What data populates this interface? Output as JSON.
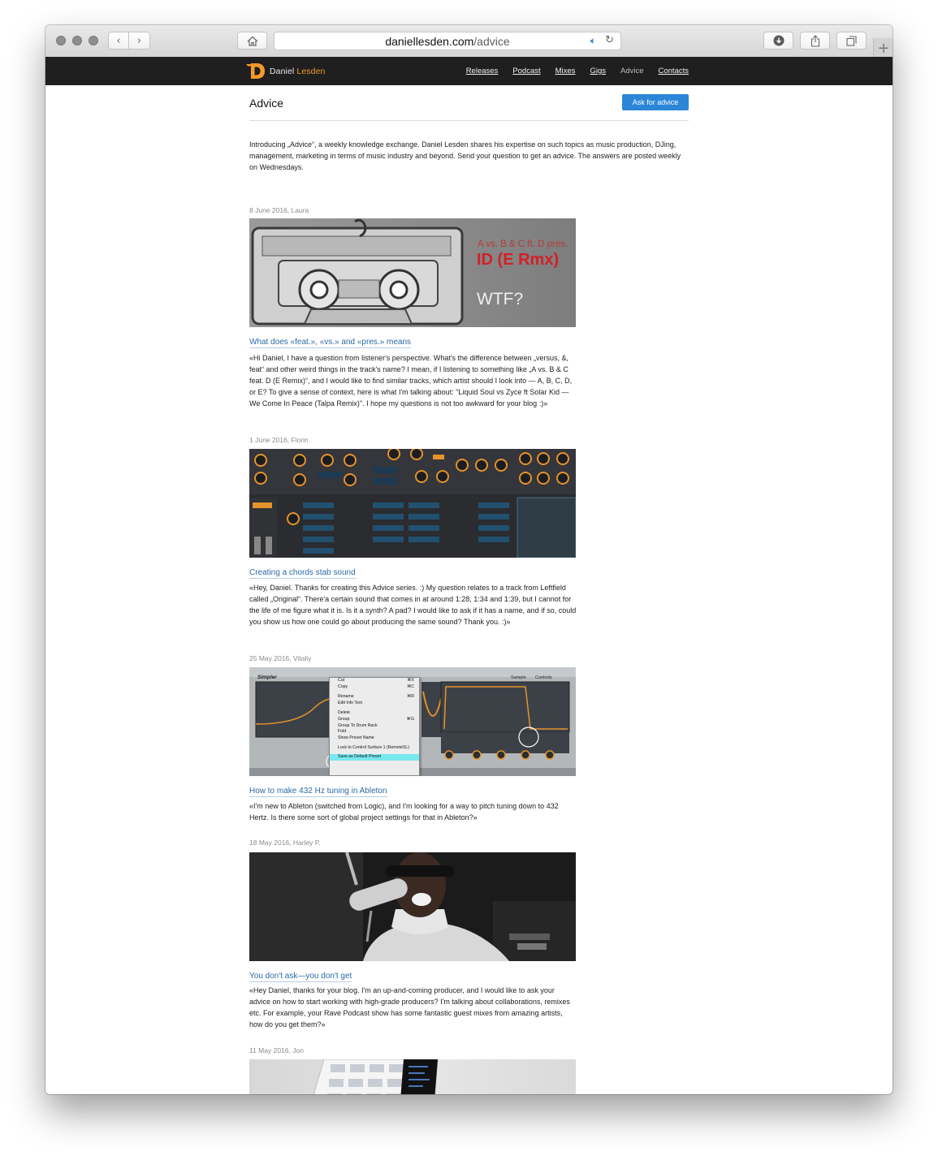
{
  "browser": {
    "url_host": "daniellesden.com",
    "url_path": "/advice"
  },
  "site": {
    "logo_first": "Daniel",
    "logo_second": "Lesden",
    "nav": [
      {
        "label": "Releases"
      },
      {
        "label": "Podcast"
      },
      {
        "label": "Mixes"
      },
      {
        "label": "Gigs"
      },
      {
        "label": "Advice"
      },
      {
        "label": "Contacts"
      }
    ]
  },
  "page": {
    "title": "Advice",
    "ask_button": "Ask for advice",
    "intro": "Introducing „Advice“, a weekly knowledge exchange. Daniel Lesden shares his expertise on such topics as music production, DJing, management, marketing in terms of music industry and beyond. Send your question to get an advice. The answers are posted weekly on Wednesdays."
  },
  "posts": [
    {
      "meta": "8 June 2016, Laura",
      "image_text": {
        "line1": "A vs. B & C ft. D pres.",
        "line2": "ID (E Rmx)",
        "line3": "WTF?"
      },
      "title": "What does «feat.», «vs.» and «pres.» means",
      "text": "«Hi Daniel, I have a question from listener's perspective. What's the difference between „versus, &, feat“ and other weird things in the track's name? I mean, if I listening to something like „A vs. B & C feat. D (E Remix)“, and I would like to find similar tracks, which artist should I look into — A, B, C, D, or E? To give a sense of context, here is what I'm talking about: \"Liquid Soul vs Zyce ft Solar Kid — We Come In Peace (Talpa Remix)\". I hope my questions is not too awkward for your blog :)»"
    },
    {
      "meta": "1 June 2016, Florin",
      "title": "Creating a chords stab sound",
      "text": "«Hey, Daniel. Thanks for creating this Advice series. :) My question relates to a track from Leftfield called „Original“. There'a certain sound that comes in at around 1:28, 1:34 and 1:39, but I cannot for the life of me figure what it is. Is it a synth? A pad? I would like to ask if it has a name, and if so, could you show us how one could go about producing the same sound? Thank you. :)»"
    },
    {
      "meta": "25 May 2016, Vitaliy",
      "image_text": {
        "device": "Simpler",
        "menu": [
          "Cut",
          "Copy",
          "Rename",
          "Edit Info Text",
          "Delete",
          "Group",
          "Group To Drum Rack",
          "Fold",
          "Show Preset Name",
          "Lock to Control Surface 1 (RemoteSL)",
          "Save as Default Preset"
        ],
        "shortcuts": [
          "⌘X",
          "⌘C",
          "⌘R",
          "⌘G"
        ],
        "tabs": [
          "Sample",
          "Controls"
        ]
      },
      "title": "How to make 432 Hz tuning in Ableton",
      "text": "«I'm new to Ableton (switched from Logic), and I'm looking for a way to pitch tuning down to 432 Hertz. Is there some sort of global project settings for that in Ableton?»"
    },
    {
      "meta": "18 May 2016, Harley P.",
      "title": "You don't ask—you don't get",
      "text": "«Hey Daniel, thanks for your blog. I'm an up-and-coming producer, and I would like to ask your advice on how to start working with high-grade producers? I'm talking about collaborations, remixes etc. For example, your Rave Podcast show has some fantastic guest mixes from amazing artists, how do you get them?»"
    },
    {
      "meta": "11 May 2016, Jon"
    }
  ]
}
